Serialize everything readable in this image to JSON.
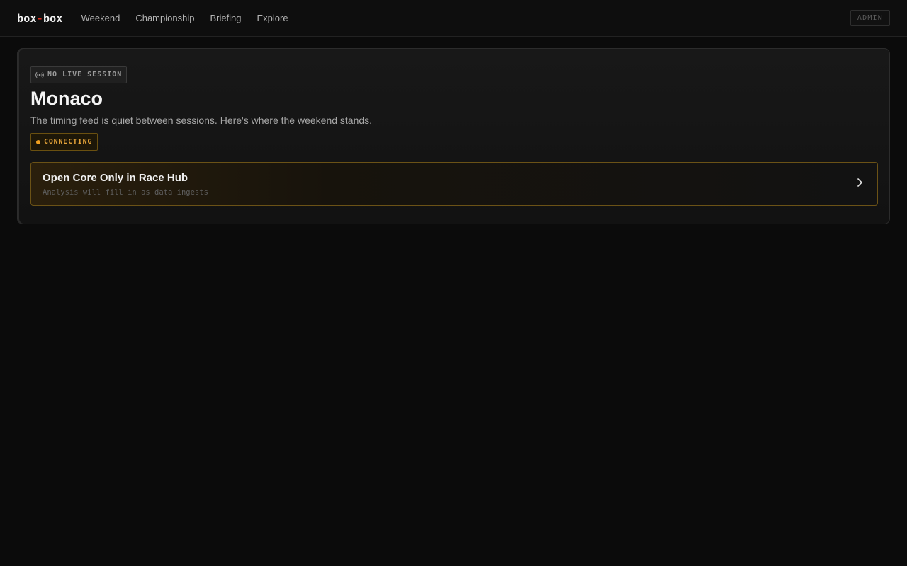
{
  "header": {
    "logo_left": "box",
    "logo_sep": "-",
    "logo_right": "box",
    "nav": [
      {
        "label": "Weekend"
      },
      {
        "label": "Championship"
      },
      {
        "label": "Briefing"
      },
      {
        "label": "Explore"
      }
    ],
    "admin_label": "ADMIN"
  },
  "session_card": {
    "live_badge": "NO LIVE SESSION",
    "live_badge_icon": "broadcast-icon",
    "title": "Monaco",
    "subtitle": "The timing feed is quiet between sessions. Here's where the weekend stands.",
    "status_label": "CONNECTING",
    "status_color": "#f0a020",
    "cta": {
      "title": "Open Core Only in Race Hub",
      "subtitle": "Analysis will fill in as data ingests",
      "icon": "chevron-right-icon"
    }
  },
  "colors": {
    "accent_red": "#e0301e",
    "accent_amber": "#e8a63a",
    "background": "#0b0b0b"
  }
}
